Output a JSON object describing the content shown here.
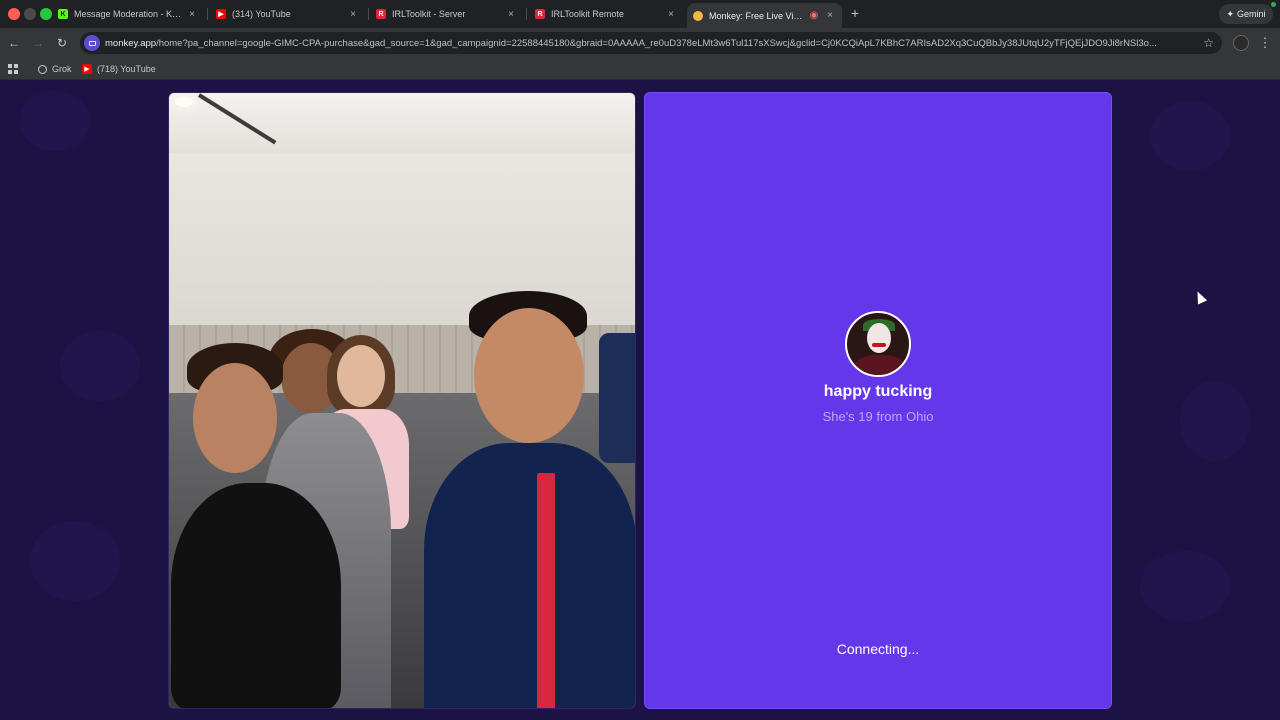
{
  "browser": {
    "tabs": [
      {
        "title": "Message Moderation - Kick D",
        "icon": "kick-icon",
        "color": "#53fc18"
      },
      {
        "title": "(314) YouTube",
        "icon": "youtube-icon",
        "color": "#ff0000"
      },
      {
        "title": "IRLToolkit - Server",
        "icon": "irltoolkit-icon",
        "color": "#e0243a"
      },
      {
        "title": "IRLToolkit Remote",
        "icon": "irltoolkit-icon",
        "color": "#e0243a"
      },
      {
        "title": "Monkey: Free Live Video C",
        "icon": "monkey-icon",
        "color": "#f2b84b",
        "active": true
      }
    ],
    "tab_close_glyph": "×",
    "new_tab_glyph": "+",
    "gemini_label": "Gemini",
    "url_host": "monkey.app",
    "url_path": "/home?pa_channel=google-GIMC-CPA-purchase&gad_source=1&gad_campaignid=22588445180&gbraid=0AAAAA_re0uD378eLMt3w6Tul117sXSwcj&gclid=Cj0KCQiApL7KBhC7ARIsAD2Xq3CuQBbJy38JUtqU2yTFjQEjJDO9Ji8rNSl3o...",
    "bookmarks": [
      {
        "label": "Grok",
        "icon": "grok-icon"
      },
      {
        "label": "(718) YouTube",
        "icon": "youtube-icon"
      }
    ]
  },
  "page": {
    "match": {
      "name": "happy tucking",
      "info": "She's 19 from Ohio",
      "status": "Connecting..."
    },
    "colors": {
      "background": "#1d1244",
      "panel": "#6438ea"
    }
  }
}
